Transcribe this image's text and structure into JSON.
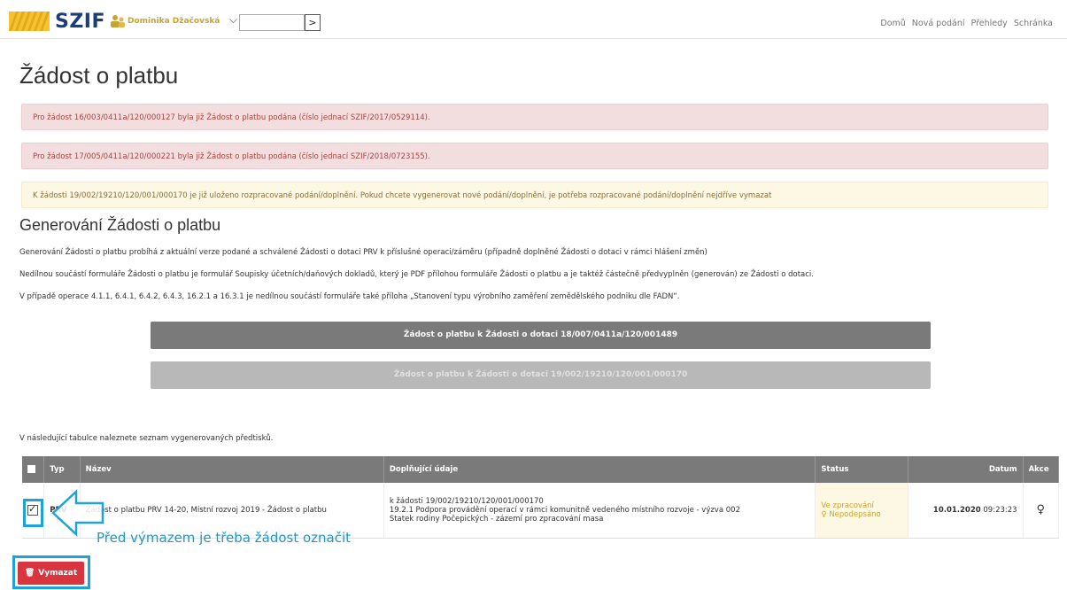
{
  "header": {
    "logo": "SZIF",
    "user_name": "Dominika Džačovská",
    "go_label": ">",
    "nav": [
      "Domů",
      "Nová podání",
      "Přehledy",
      "Schránka"
    ]
  },
  "page_title": "Žádost o platbu",
  "alerts": [
    "Pro žádost 16/003/0411a/120/000127 byla již Žádost o platbu podána (číslo jednací SZIF/2017/0529114).",
    "Pro žádost 17/005/0411a/120/000221 byla již Žádost o platbu podána (číslo jednací SZIF/2018/0723155).",
    "K žádosti 19/002/19210/120/001/000170 je již uloženo rozpracované podání/doplnění. Pokud chcete vygenerovat nové podání/doplnění, je potřeba rozpracované podání/doplnění nejdříve vymazat"
  ],
  "section_title": "Generování Žádosti o platbu",
  "paragraphs": [
    "Generování Žádosti o platbu probíhá z aktuální verze podané a schválené Žádosti o dotaci PRV k příslušné operaci/záměru (případně doplněné Žádosti o dotaci v rámci hlášení změn)",
    "Nedílnou součástí formuláře Žádosti o platbu je formulář Soupisky účetních/daňových dokladů, který je PDF přílohou formuláře Žádosti o platbu a je taktéž částečně předvyplněn (generován) ze Žádosti o dotaci.",
    "V případě operace 4.1.1, 6.4.1, 6.4.2, 6.4.3, 16.2.1 a 16.3.1 je nedílnou součástí formuláře také příloha „Stanovení typu výrobního zaměření zemědělského podniku dle FADN“."
  ],
  "buttons": {
    "gen1": "Žádost o platbu k Žádosti o dotaci 18/007/0411a/120/001489",
    "gen2": "Žádost o platbu k Žádosti o dotaci 19/002/19210/120/001/000170",
    "delete": "Vymazat"
  },
  "table_caption": "V následující tabulce naleznete seznam vygenerovaných předtisků.",
  "table": {
    "headers": {
      "typ": "Typ",
      "nazev": "Název",
      "doplnujici": "Doplňující údaje",
      "status": "Status",
      "datum": "Datum",
      "akce": "Akce"
    },
    "row": {
      "typ": "PRV",
      "nazev": "Žádost o platbu PRV 14-20, Místní rozvoj 2019 - Žádost o platbu",
      "doplnujici_1": "k žádosti 19/002/19210/120/001/000170",
      "doplnujici_2": "19.2.1 Podpora provádění operací v rámci komunitně vedeného místního rozvoje - výzva 002",
      "doplnujici_3": "Statek rodiny Počepických - zázemí pro zpracování masa",
      "status_1": "Ve zpracování",
      "status_2": "Nepodepsáno",
      "datum_date": "10.01.2020",
      "datum_time": "09:23:23"
    }
  },
  "annotation": "Před výmazem je třeba žádost označit",
  "colors": {
    "brand": "#1d3d7a",
    "gold": "#c9a332",
    "danger": "#d9353f",
    "annotation": "#1ea3d8"
  }
}
